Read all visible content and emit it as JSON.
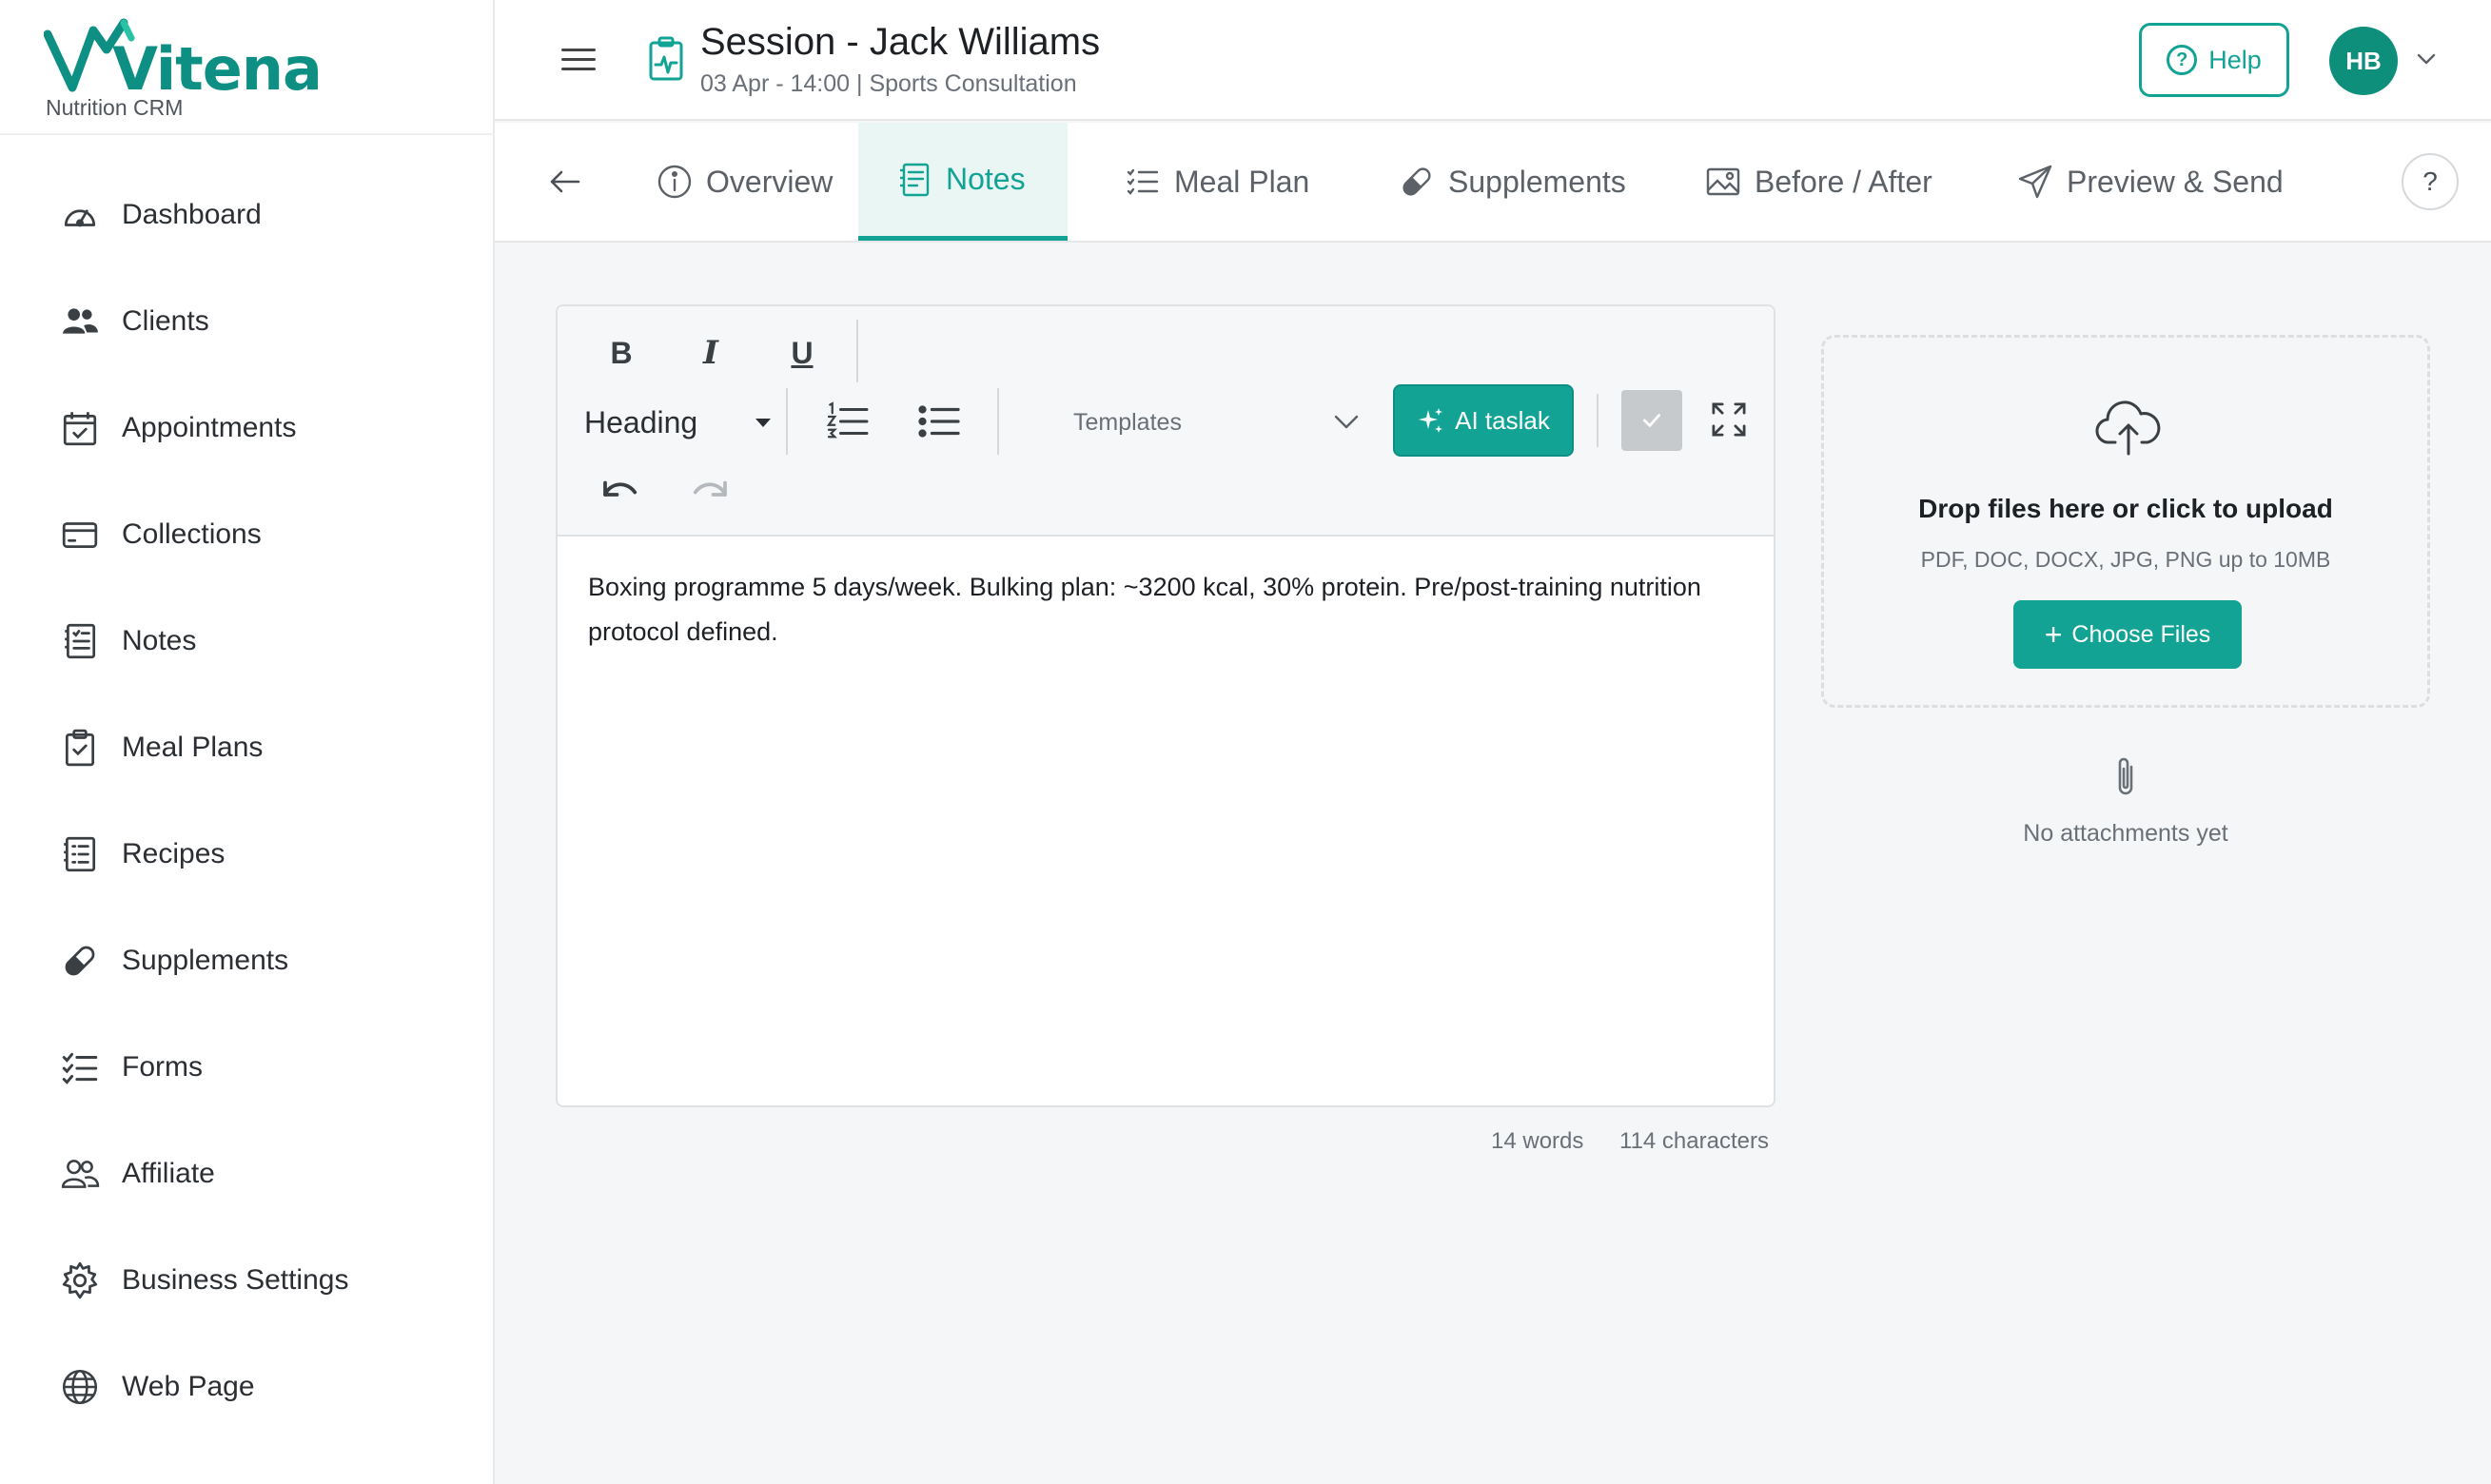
{
  "brand": {
    "name": "Vitena",
    "tagline": "Nutrition CRM",
    "accent": "#12a394"
  },
  "sidebar": {
    "items": [
      {
        "label": "Dashboard",
        "icon": "dashboard-gauge-icon"
      },
      {
        "label": "Clients",
        "icon": "users-icon"
      },
      {
        "label": "Appointments",
        "icon": "calendar-icon"
      },
      {
        "label": "Collections",
        "icon": "credit-card-icon"
      },
      {
        "label": "Notes",
        "icon": "notes-icon"
      },
      {
        "label": "Meal Plans",
        "icon": "clipboard-icon"
      },
      {
        "label": "Recipes",
        "icon": "recipe-list-icon"
      },
      {
        "label": "Supplements",
        "icon": "pill-icon"
      },
      {
        "label": "Forms",
        "icon": "checklist-icon"
      },
      {
        "label": "Affiliate",
        "icon": "affiliate-users-icon"
      },
      {
        "label": "Business Settings",
        "icon": "gear-icon"
      },
      {
        "label": "Web Page",
        "icon": "globe-icon"
      }
    ]
  },
  "header": {
    "title": "Session - Jack Williams",
    "subtitle": "03 Apr - 14:00 | Sports Consultation",
    "help_label": "Help",
    "avatar_initials": "HB"
  },
  "tabs": [
    {
      "label": "Overview",
      "icon": "info-icon",
      "active": false
    },
    {
      "label": "Notes",
      "icon": "notes-icon",
      "active": true
    },
    {
      "label": "Meal Plan",
      "icon": "list-icon",
      "active": false
    },
    {
      "label": "Supplements",
      "icon": "pill-icon",
      "active": false
    },
    {
      "label": "Before / After",
      "icon": "image-icon",
      "active": false
    },
    {
      "label": "Preview & Send",
      "icon": "send-icon",
      "active": false
    }
  ],
  "tab_help": "?",
  "editor": {
    "toolbar": {
      "bold": "B",
      "italic": "I",
      "underline": "U",
      "heading_value": "Heading",
      "templates_placeholder": "Templates",
      "ai_label": "AI taslak"
    },
    "content": "Boxing programme 5 days/week. Bulking plan: ~3200 kcal, 30% protein. Pre/post-training nutrition protocol defined.",
    "word_count": "14 words",
    "char_count": "114 characters"
  },
  "upload": {
    "title": "Drop files here or click to upload",
    "subtitle": "PDF, DOC, DOCX, JPG, PNG up to 10MB",
    "button_label": "Choose Files",
    "empty_text": "No attachments yet"
  }
}
